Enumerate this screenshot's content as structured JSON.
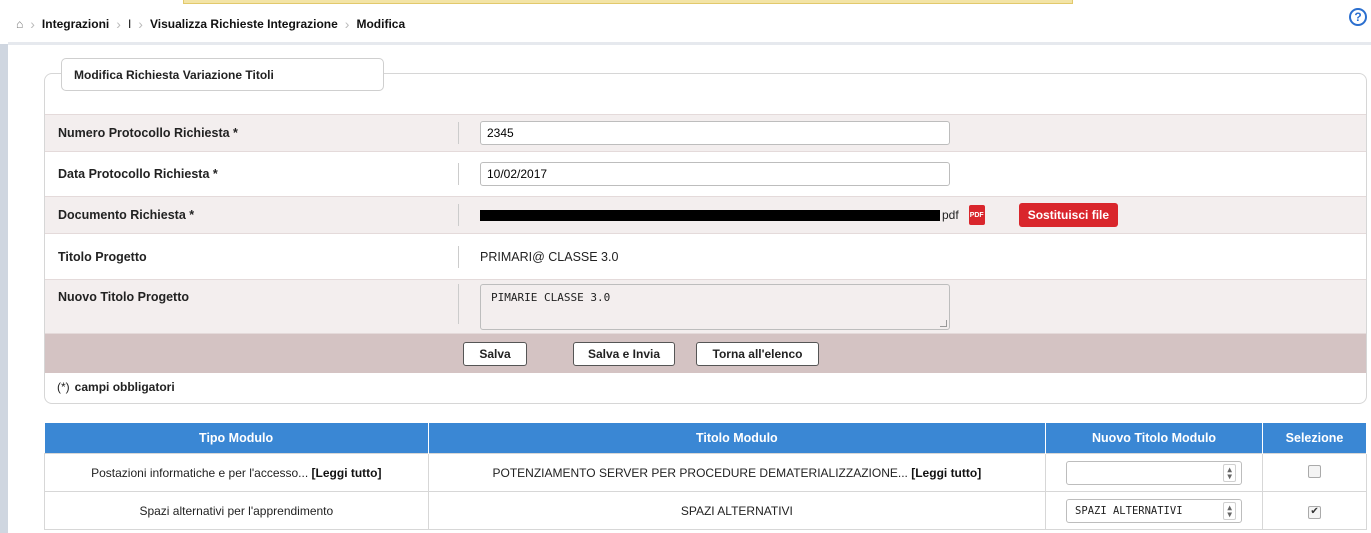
{
  "breadcrumb": {
    "home_icon": "home-icon",
    "items": [
      "Integrazioni",
      "I",
      "Visualizza Richieste Integrazione",
      "Modifica"
    ]
  },
  "help_icon": "?",
  "form": {
    "legend": "Modifica Richiesta Variazione Titoli",
    "numero_label": "Numero Protocollo Richiesta *",
    "numero_value": "2345",
    "data_label": "Data Protocollo Richiesta *",
    "data_value": "10/02/2017",
    "documento_label": "Documento Richiesta *",
    "documento_ext": "pdf",
    "pdf_icon_label": "PDF",
    "sostituisci_label": "Sostituisci file",
    "titolo_label": "Titolo Progetto",
    "titolo_value": "PRIMARI@ CLASSE 3.0",
    "nuovo_titolo_label": "Nuovo Titolo Progetto",
    "nuovo_titolo_value": "PIMARIE CLASSE 3.0",
    "btn_salva": "Salva",
    "btn_salva_invia": "Salva e Invia",
    "btn_torna": "Torna all'elenco",
    "required_paren": "(*)",
    "required_note": "campi obbligatori"
  },
  "table": {
    "headers": [
      "Tipo Modulo",
      "Titolo Modulo",
      "Nuovo Titolo Modulo",
      "Selezione"
    ],
    "rows": [
      {
        "tipo": "Postazioni informatiche e per l'accesso...",
        "tipo_more": "[Leggi tutto]",
        "titolo": "POTENZIAMENTO SERVER PER PROCEDURE DEMATERIALIZZAZIONE...",
        "titolo_more": "[Leggi tutto]",
        "nuovo": "",
        "selected": false
      },
      {
        "tipo": "Spazi alternativi per l'apprendimento",
        "tipo_more": "",
        "titolo": "SPAZI ALTERNATIVI",
        "titolo_more": "",
        "nuovo": "SPAZI ALTERNATIVI",
        "selected": true
      }
    ]
  },
  "colors": {
    "header_blue": "#3a87d4",
    "action_bar": "#d4c3c3",
    "red_button": "#d9262c"
  }
}
